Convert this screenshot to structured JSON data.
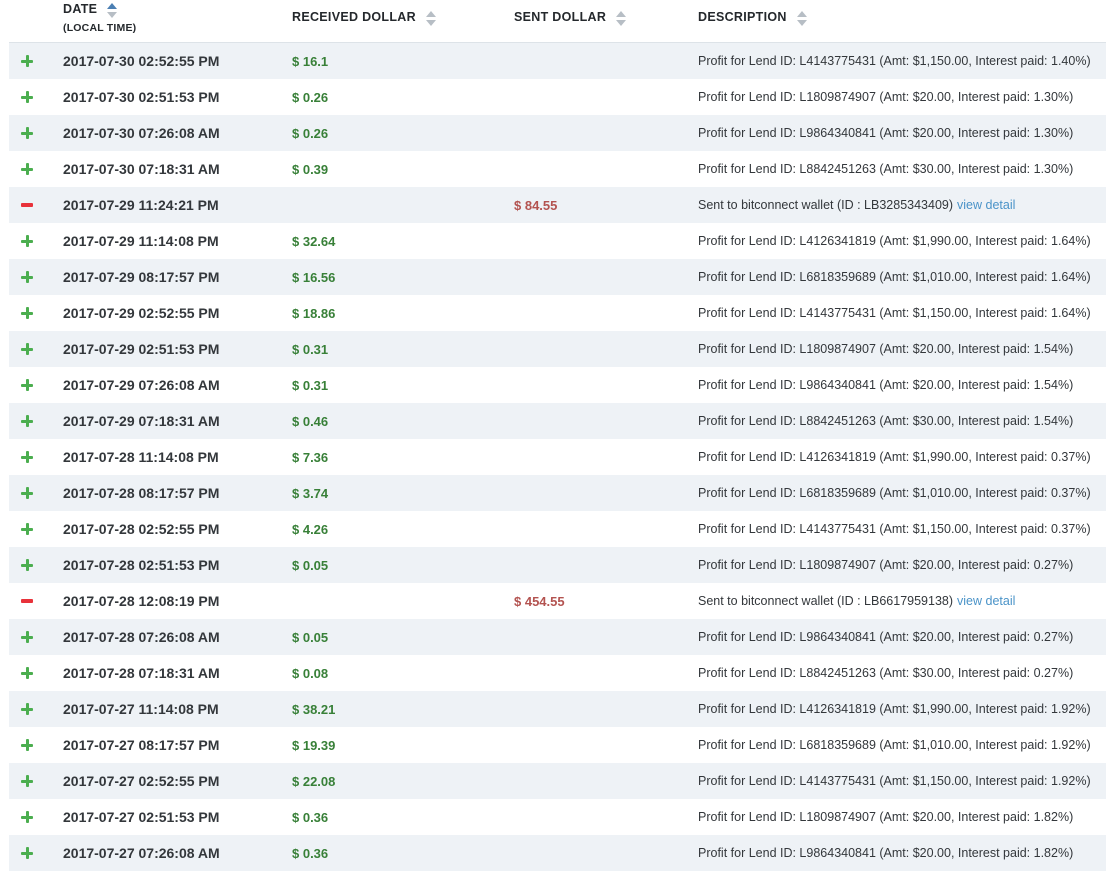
{
  "table": {
    "header": {
      "date": {
        "label": "DATE",
        "sublabel": "(LOCAL TIME)",
        "sort_state": "up-active"
      },
      "received": {
        "label": "RECEIVED DOLLAR",
        "sort_state": "none"
      },
      "sent": {
        "label": "SENT DOLLAR",
        "sort_state": "none"
      },
      "description": {
        "label": "DESCRIPTION",
        "sort_state": "none"
      }
    },
    "link_label": "view detail",
    "rows": [
      {
        "type": "in",
        "date": "2017-07-30 02:52:55 PM",
        "received": "$ 16.1",
        "sent": "",
        "description": "Profit for Lend ID: L4143775431 (Amt: $1,150.00, Interest paid: 1.40%)",
        "link": null
      },
      {
        "type": "in",
        "date": "2017-07-30 02:51:53 PM",
        "received": "$ 0.26",
        "sent": "",
        "description": "Profit for Lend ID: L1809874907 (Amt: $20.00, Interest paid: 1.30%)",
        "link": null
      },
      {
        "type": "in",
        "date": "2017-07-30 07:26:08 AM",
        "received": "$ 0.26",
        "sent": "",
        "description": "Profit for Lend ID: L9864340841 (Amt: $20.00, Interest paid: 1.30%)",
        "link": null
      },
      {
        "type": "in",
        "date": "2017-07-30 07:18:31 AM",
        "received": "$ 0.39",
        "sent": "",
        "description": "Profit for Lend ID: L8842451263 (Amt: $30.00, Interest paid: 1.30%)",
        "link": null
      },
      {
        "type": "out",
        "date": "2017-07-29 11:24:21 PM",
        "received": "",
        "sent": "$ 84.55",
        "description": "Sent to bitconnect wallet (ID : LB3285343409)",
        "link": "view detail"
      },
      {
        "type": "in",
        "date": "2017-07-29 11:14:08 PM",
        "received": "$ 32.64",
        "sent": "",
        "description": "Profit for Lend ID: L4126341819 (Amt: $1,990.00, Interest paid: 1.64%)",
        "link": null
      },
      {
        "type": "in",
        "date": "2017-07-29 08:17:57 PM",
        "received": "$ 16.56",
        "sent": "",
        "description": "Profit for Lend ID: L6818359689 (Amt: $1,010.00, Interest paid: 1.64%)",
        "link": null
      },
      {
        "type": "in",
        "date": "2017-07-29 02:52:55 PM",
        "received": "$ 18.86",
        "sent": "",
        "description": "Profit for Lend ID: L4143775431 (Amt: $1,150.00, Interest paid: 1.64%)",
        "link": null
      },
      {
        "type": "in",
        "date": "2017-07-29 02:51:53 PM",
        "received": "$ 0.31",
        "sent": "",
        "description": "Profit for Lend ID: L1809874907 (Amt: $20.00, Interest paid: 1.54%)",
        "link": null
      },
      {
        "type": "in",
        "date": "2017-07-29 07:26:08 AM",
        "received": "$ 0.31",
        "sent": "",
        "description": "Profit for Lend ID: L9864340841 (Amt: $20.00, Interest paid: 1.54%)",
        "link": null
      },
      {
        "type": "in",
        "date": "2017-07-29 07:18:31 AM",
        "received": "$ 0.46",
        "sent": "",
        "description": "Profit for Lend ID: L8842451263 (Amt: $30.00, Interest paid: 1.54%)",
        "link": null
      },
      {
        "type": "in",
        "date": "2017-07-28 11:14:08 PM",
        "received": "$ 7.36",
        "sent": "",
        "description": "Profit for Lend ID: L4126341819 (Amt: $1,990.00, Interest paid: 0.37%)",
        "link": null
      },
      {
        "type": "in",
        "date": "2017-07-28 08:17:57 PM",
        "received": "$ 3.74",
        "sent": "",
        "description": "Profit for Lend ID: L6818359689 (Amt: $1,010.00, Interest paid: 0.37%)",
        "link": null
      },
      {
        "type": "in",
        "date": "2017-07-28 02:52:55 PM",
        "received": "$ 4.26",
        "sent": "",
        "description": "Profit for Lend ID: L4143775431 (Amt: $1,150.00, Interest paid: 0.37%)",
        "link": null
      },
      {
        "type": "in",
        "date": "2017-07-28 02:51:53 PM",
        "received": "$ 0.05",
        "sent": "",
        "description": "Profit for Lend ID: L1809874907 (Amt: $20.00, Interest paid: 0.27%)",
        "link": null
      },
      {
        "type": "out",
        "date": "2017-07-28 12:08:19 PM",
        "received": "",
        "sent": "$ 454.55",
        "description": "Sent to bitconnect wallet (ID : LB6617959138)",
        "link": "view detail"
      },
      {
        "type": "in",
        "date": "2017-07-28 07:26:08 AM",
        "received": "$ 0.05",
        "sent": "",
        "description": "Profit for Lend ID: L9864340841 (Amt: $20.00, Interest paid: 0.27%)",
        "link": null
      },
      {
        "type": "in",
        "date": "2017-07-28 07:18:31 AM",
        "received": "$ 0.08",
        "sent": "",
        "description": "Profit for Lend ID: L8842451263 (Amt: $30.00, Interest paid: 0.27%)",
        "link": null
      },
      {
        "type": "in",
        "date": "2017-07-27 11:14:08 PM",
        "received": "$ 38.21",
        "sent": "",
        "description": "Profit for Lend ID: L4126341819 (Amt: $1,990.00, Interest paid: 1.92%)",
        "link": null
      },
      {
        "type": "in",
        "date": "2017-07-27 08:17:57 PM",
        "received": "$ 19.39",
        "sent": "",
        "description": "Profit for Lend ID: L6818359689 (Amt: $1,010.00, Interest paid: 1.92%)",
        "link": null
      },
      {
        "type": "in",
        "date": "2017-07-27 02:52:55 PM",
        "received": "$ 22.08",
        "sent": "",
        "description": "Profit for Lend ID: L4143775431 (Amt: $1,150.00, Interest paid: 1.92%)",
        "link": null
      },
      {
        "type": "in",
        "date": "2017-07-27 02:51:53 PM",
        "received": "$ 0.36",
        "sent": "",
        "description": "Profit for Lend ID: L1809874907 (Amt: $20.00, Interest paid: 1.82%)",
        "link": null
      },
      {
        "type": "in",
        "date": "2017-07-27 07:26:08 AM",
        "received": "$ 0.36",
        "sent": "",
        "description": "Profit for Lend ID: L9864340841 (Amt: $20.00, Interest paid: 1.82%)",
        "link": null
      }
    ]
  },
  "colors": {
    "stripe_row": "#eef2f6",
    "plus_icon": "#4bae4f",
    "minus_icon": "#e8323a",
    "received_amount": "#388038",
    "sent_amount": "#b35350",
    "link": "#4a93c8",
    "sort_active": "#4b7fb3",
    "sort_inactive": "#b7bec5",
    "header_border": "#dde3e8"
  }
}
